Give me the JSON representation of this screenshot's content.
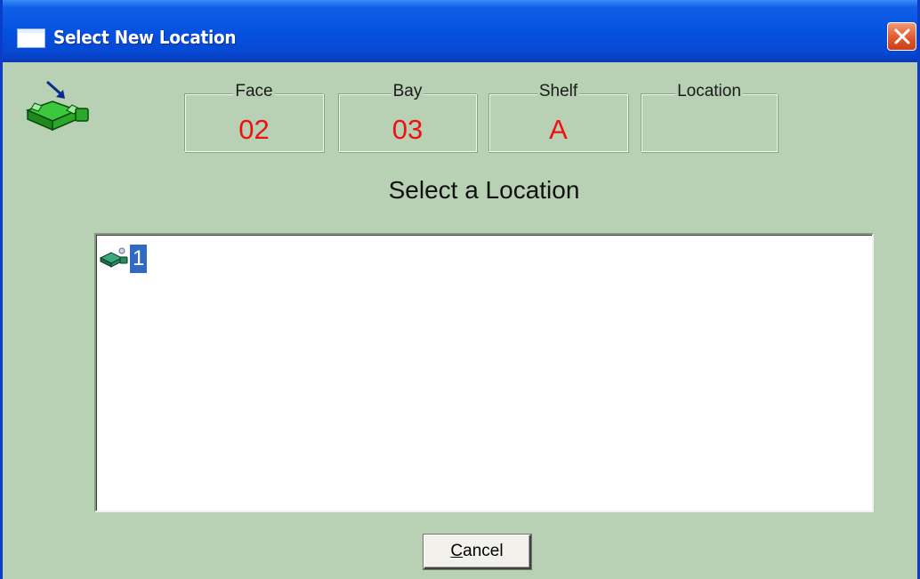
{
  "window": {
    "title": "Select New Location"
  },
  "fields": [
    {
      "label": "Face",
      "value": "02"
    },
    {
      "label": "Bay",
      "value": "03"
    },
    {
      "label": "Shelf",
      "value": "A"
    },
    {
      "label": "Location",
      "value": ""
    }
  ],
  "heading": "Select a Location",
  "tree": {
    "items": [
      {
        "label": "1",
        "selected": true,
        "icon": "location-icon"
      }
    ]
  },
  "buttons": {
    "cancel_accel": "C",
    "cancel_rest": "ancel"
  },
  "colors": {
    "dialog_bg": "#b8d0b4",
    "titlebar": "#0552e0",
    "value_text": "#ee1111",
    "selection": "#316ac5"
  }
}
